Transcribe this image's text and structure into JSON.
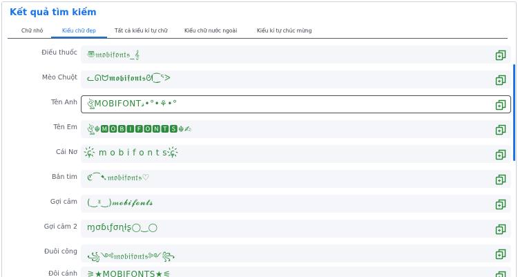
{
  "header": {
    "title": "Kết quả tìm kiếm"
  },
  "tabs": [
    {
      "label": "Chữ nhỏ"
    },
    {
      "label": "Kiểu chữ đẹp"
    },
    {
      "label": "Tất cả kiểu kí tự chữ"
    },
    {
      "label": "Kiểu chữ nước ngoài"
    },
    {
      "label": "Kiểu kí tự chúc mừng"
    }
  ],
  "active_tab": "Kiểu chữ đẹp",
  "results": [
    {
      "label": "Điếu thuốc",
      "text": "〠𝔪𝔬𝔟𝔦𝔣𝔬𝔫𝔱𝔰_𝄞"
    },
    {
      "label": "Mèo Chuột",
      "text": "ᓚᘏᗢ𝖒𝖔𝖇𝖎𝖋𝖔𝖓𝖙𝖘ᘛ⁐̤ᕐᐷ"
    },
    {
      "label": "Tên Anh",
      "text": "ঔৣMOBIFONT𝓈•°•⚘•°"
    },
    {
      "label": "Tên Em",
      "text": "ঔৣ☬🅼🅾🅱🅸🅵🅾🅽🆃🆂☬✍"
    },
    {
      "label": "Cái Nơ",
      "text": "ɕ҉ m o b i f o n t s ɕ҉"
    },
    {
      "label": "Bắn tim",
      "text": "ℭ⁀➷𝔪𝔬𝔟𝔦𝔣𝔬𝔫𝔱𝔰♡"
    },
    {
      "label": "Gợi cảm",
      "text": "(‿ˠ‿)𝓂𝓸𝓫𝓲𝓯𝓸𝓷𝓽𝓼"
    },
    {
      "label": "Gợi cảm 2",
      "text": "ɱσɓιƒσɳƚʂ◯‿◯"
    },
    {
      "label": "Đuôi công",
      "text": "꧁༺𝔪𝔬𝔟𝔦𝔣𝔬𝔫𝔱𝔰༻꧂"
    },
    {
      "label": "Đôi cánh",
      "text": "⚞★MOBIFONTS★⚟"
    }
  ],
  "selected_index": 2,
  "icons": {
    "copy": "copy-icon"
  },
  "colors": {
    "accent": "#1a73e8",
    "fancy_text": "#2e8b3e",
    "row_bg": "#f4f6f9"
  }
}
